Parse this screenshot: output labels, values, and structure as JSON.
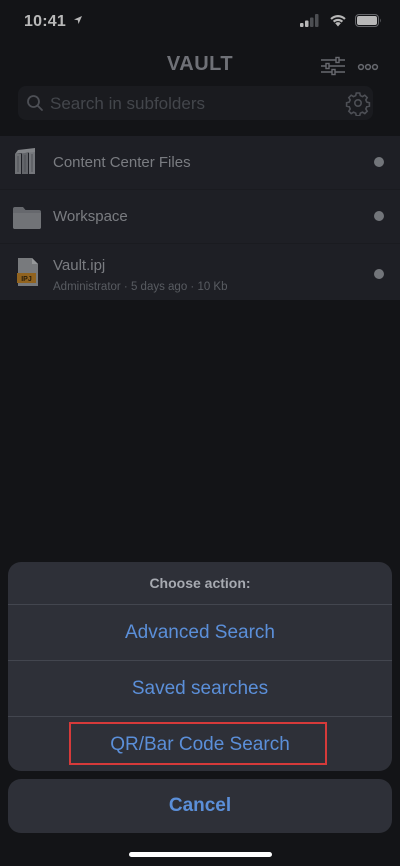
{
  "status_bar": {
    "time": "10:41"
  },
  "header": {
    "title": "VAULT"
  },
  "search": {
    "placeholder": "Search in subfolders"
  },
  "list": {
    "items": [
      {
        "name": "Content Center Files",
        "icon": "content-center-folder-icon"
      },
      {
        "name": "Workspace",
        "icon": "folder-icon"
      },
      {
        "name": "Vault.ipj",
        "meta": "Administrator · 5 days ago · 10 Kb",
        "icon": "ipj-file-icon",
        "badge": "IPJ"
      }
    ]
  },
  "action_sheet": {
    "title": "Choose action:",
    "options": [
      {
        "label": "Advanced Search"
      },
      {
        "label": "Saved searches"
      },
      {
        "label": "QR/Bar Code Search"
      }
    ],
    "cancel": "Cancel"
  },
  "colors": {
    "accent": "#5b8fd9",
    "highlight": "#d63a3a",
    "background": "#1b1c20",
    "list_background": "#2a2c34",
    "sheet_background": "#2e3038"
  }
}
